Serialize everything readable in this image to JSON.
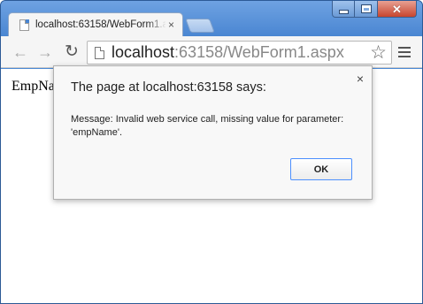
{
  "tab": {
    "title": "localhost:63158/WebForm1.aspx",
    "close_glyph": "×",
    "favicon": "page-icon"
  },
  "window_controls": {
    "close_glyph": "✕"
  },
  "toolbar": {
    "back_glyph": "←",
    "forward_glyph": "→",
    "reload_glyph": "↻",
    "url_host": "localhost",
    "url_rest": ":63158/WebForm1.aspx",
    "star_glyph": "☆"
  },
  "page": {
    "text": "EmpNa"
  },
  "dialog": {
    "heading": "The page at localhost:63158 says:",
    "message": "Message: Invalid web service call, missing value for parameter: 'empName'.",
    "ok_label": "OK",
    "close_glyph": "×"
  },
  "colors": {
    "title_bar": "#4a89d6",
    "ok_border": "#4d90fe"
  }
}
